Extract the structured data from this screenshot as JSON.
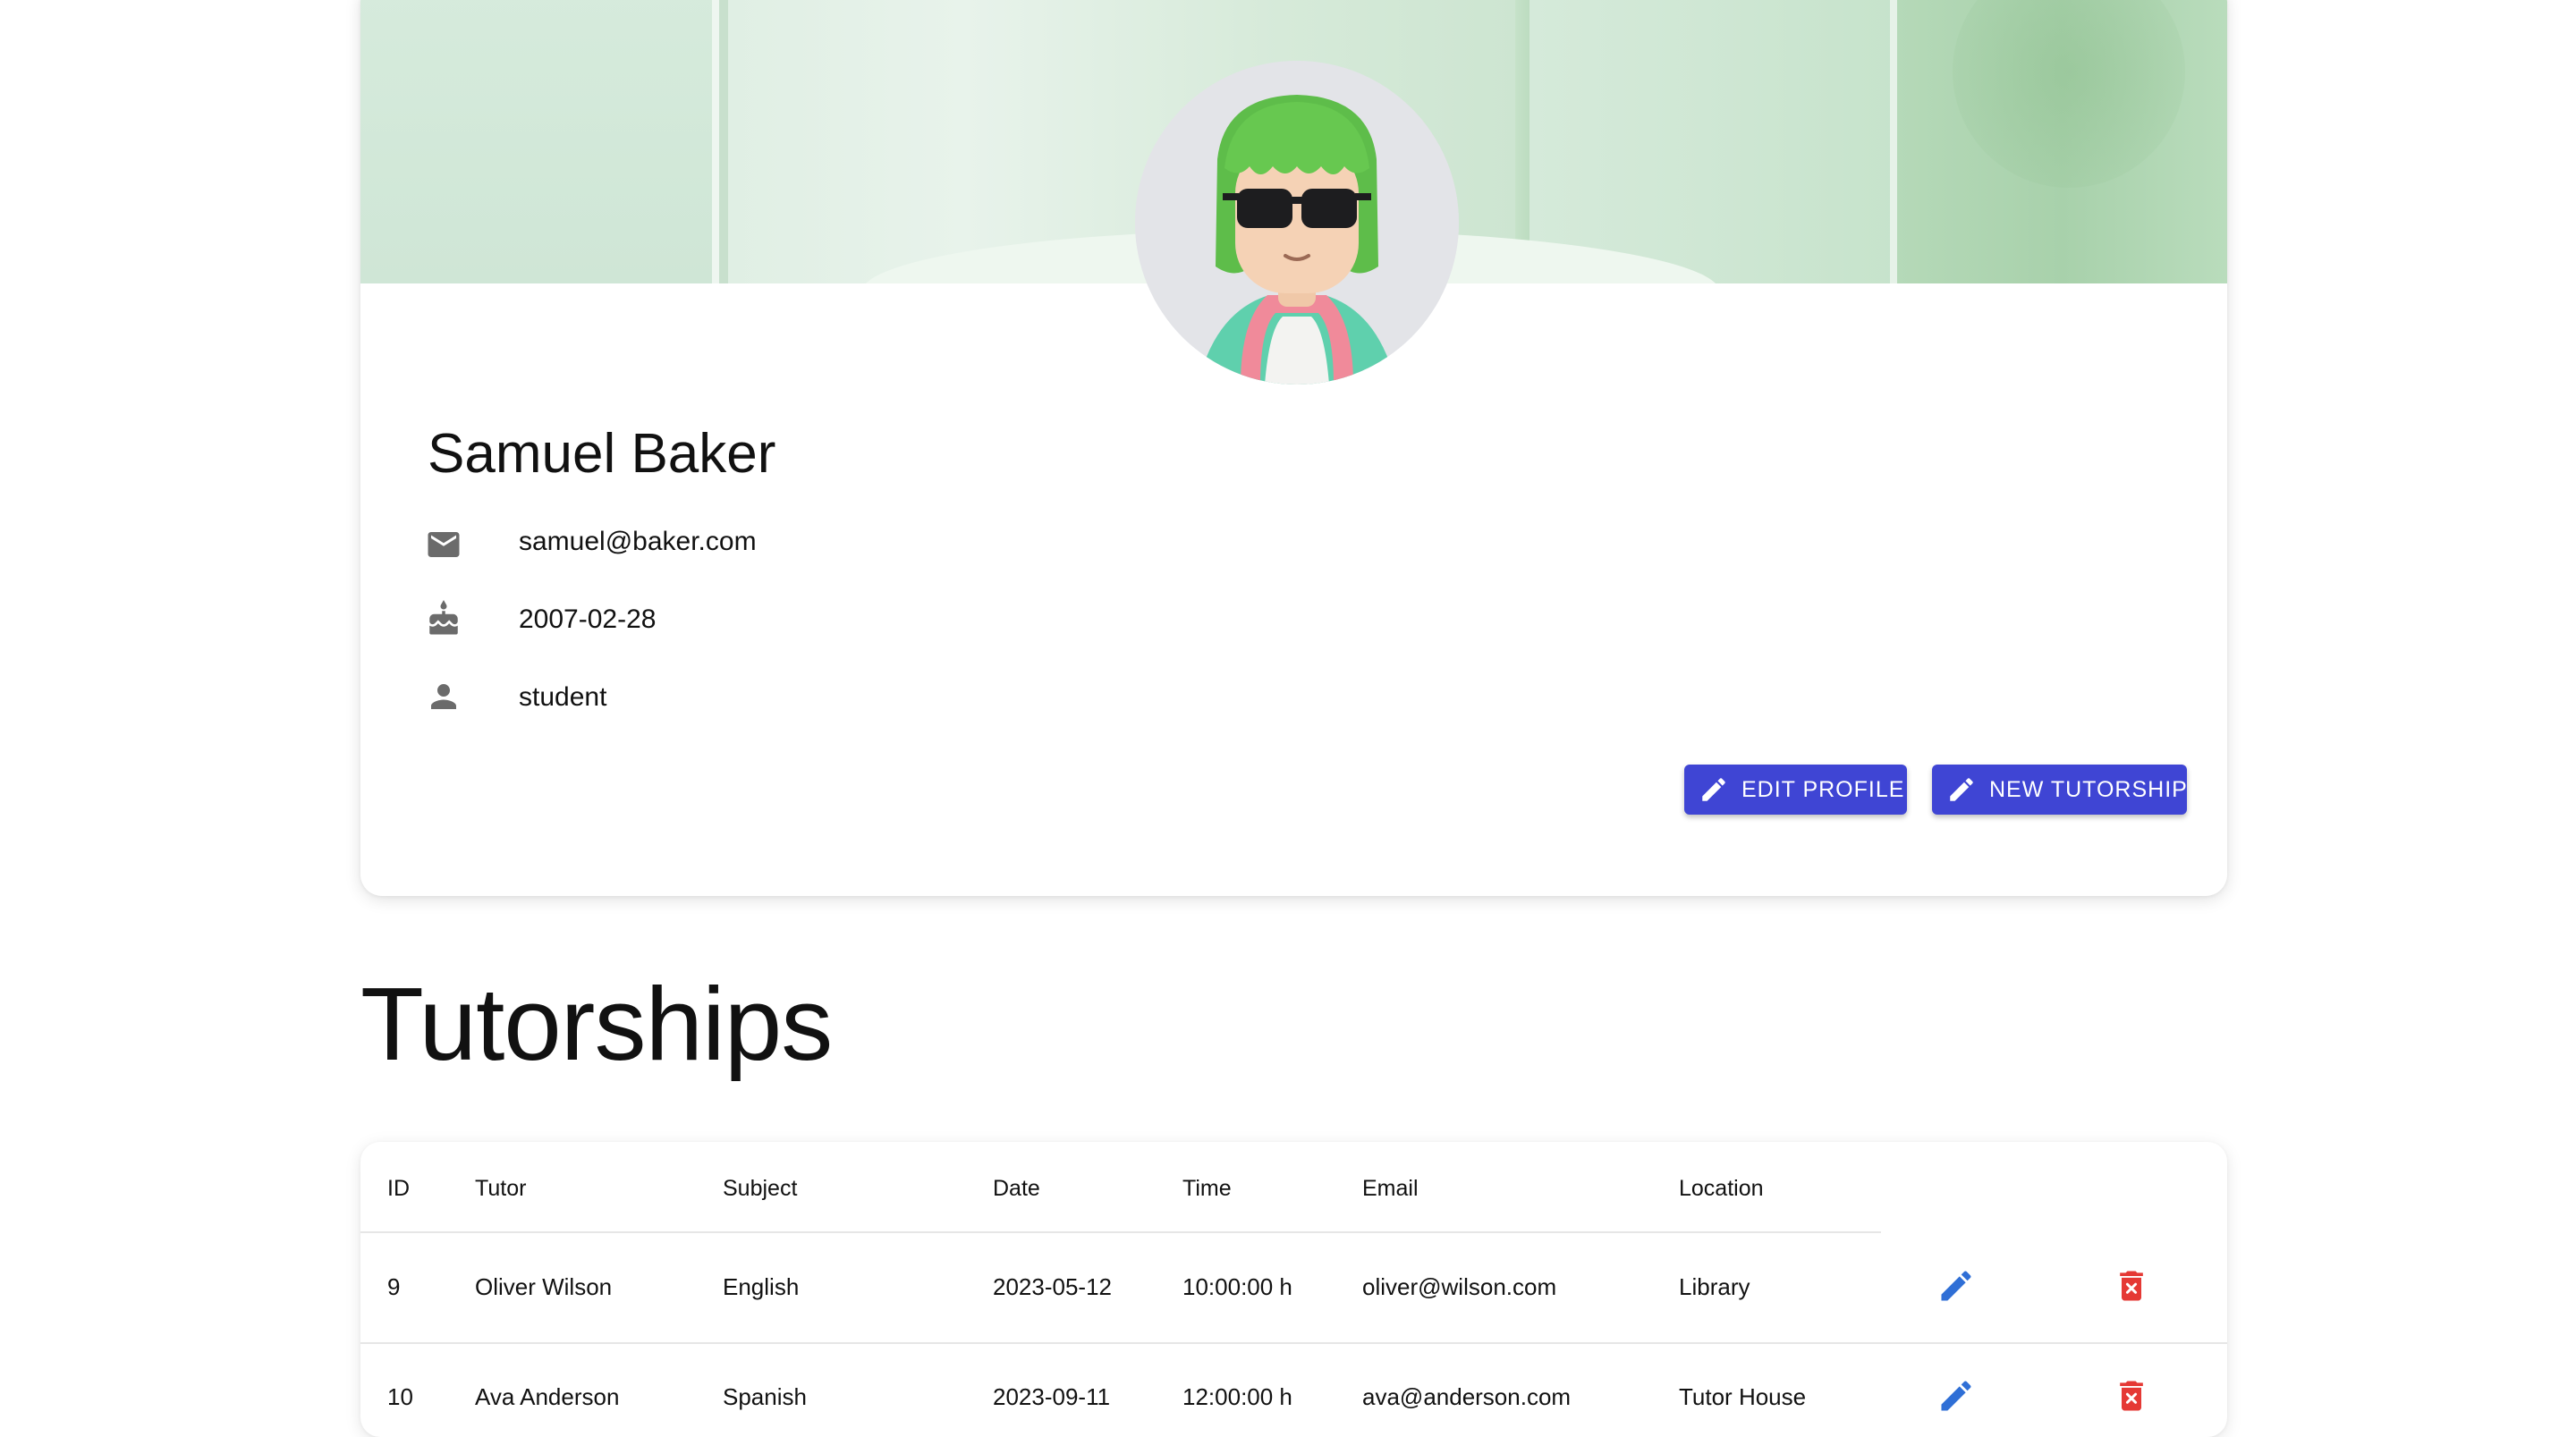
{
  "profile": {
    "name": "Samuel Baker",
    "email": "samuel@baker.com",
    "birthdate": "2007-02-28",
    "role": "student",
    "buttons": {
      "edit_profile": "EDIT PROFILE",
      "new_tutorship": "NEW TUTORSHIP"
    }
  },
  "tutorships": {
    "title": "Tutorships",
    "columns": [
      "ID",
      "Tutor",
      "Subject",
      "Date",
      "Time",
      "Email",
      "Location"
    ],
    "rows": [
      {
        "id": "9",
        "tutor": "Oliver Wilson",
        "subject": "English",
        "date": "2023-05-12",
        "time": "10:00:00 h",
        "email": "oliver@wilson.com",
        "location": "Library"
      },
      {
        "id": "10",
        "tutor": "Ava Anderson",
        "subject": "Spanish",
        "date": "2023-09-11",
        "time": "12:00:00 h",
        "email": "ava@anderson.com",
        "location": "Tutor House"
      }
    ]
  },
  "icons": {
    "email": "mail-icon",
    "birthdate": "cake-icon",
    "role": "person-icon",
    "edit": "pencil-icon",
    "delete": "delete-icon"
  },
  "colors": {
    "primary_button": "#3f45d4",
    "edit_icon": "#2f6fd6",
    "delete_icon": "#e53935",
    "info_icon": "#6b6b6b"
  }
}
